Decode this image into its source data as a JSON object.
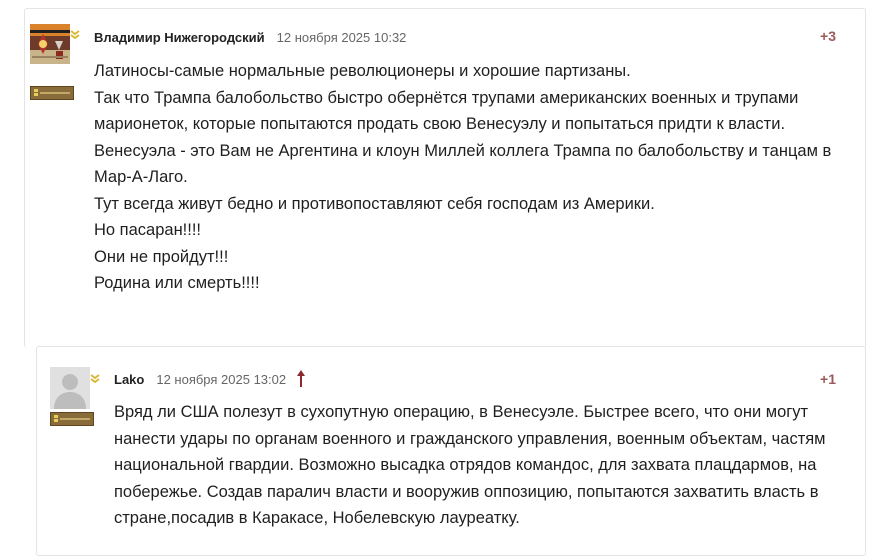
{
  "comments": [
    {
      "author": "Владимир Нижегородский",
      "date": "12 ноября 2025 10:32",
      "score": "+3",
      "paragraphs": [
        "Латиносы-самые нормальные революционеры и хорошие партизаны.",
        "Так что Трампа балобольство быстро обернётся трупами американских военных и трупами марионеток, которые попытаются продать свою Венесуэлу и попытаться придти к власти.",
        "Венесуэла - это Вам не Аргентина и клоун Миллей коллега Трампа по балобольству и танцам в Мар-А-Лаго.",
        "Тут всегда живут бедно и противопоставляют себя господам из Америки.",
        "Но пасаран!!!!",
        "Они не пройдут!!!",
        "Родина или смерть!!!!"
      ],
      "avatar_icon": "user-avatar-medal-image",
      "rank_badge_icon": "rank-chevron-icon"
    },
    {
      "author": "Lako",
      "date": "12 ноября 2025 13:02",
      "score": "+1",
      "paragraphs": [
        "Вряд ли США полезут в сухопутную операцию, в Венесуэле. Быстрее всего, что они могут нанести удары по органам военного и гражданского управления, военным объектам, частям национальной гвардии. Возможно высадка отрядов командос, для захвата плацдармов, на побережье. Создав паралич власти и вооружив оппозицию, попытаются захватить власть в стране,посадив в Каракасе, Нобелевскую лауреатку."
      ],
      "avatar_icon": "default-user-silhouette-icon",
      "rank_badge_icon": "rank-chevron-icon",
      "reply_to_icon": "arrow-up-icon"
    }
  ],
  "colors": {
    "score": "#9b5a5a",
    "reply_arrow": "#8b2a2a",
    "rank_bar": "#8a6c3a",
    "rank_badge": "#d8b93a",
    "border": "#e4e4e4"
  }
}
